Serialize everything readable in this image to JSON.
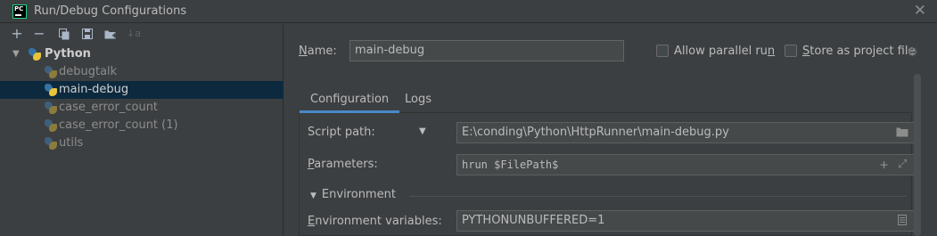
{
  "window": {
    "title": "Run/Debug Configurations",
    "logo_text": "PC"
  },
  "toolbar": {
    "add": "+",
    "remove": "−",
    "sort": "↓a"
  },
  "tree": {
    "group_label": "Python",
    "items": [
      {
        "label": "debugtalk",
        "selected": false
      },
      {
        "label": "main-debug",
        "selected": true
      },
      {
        "label": "case_error_count",
        "selected": false
      },
      {
        "label": "case_error_count (1)",
        "selected": false
      },
      {
        "label": "utils",
        "selected": false
      }
    ]
  },
  "config": {
    "name_label_rest": "ame:",
    "name_label_mnemonic": "N",
    "name_value": "main-debug",
    "allow_parallel_label": "Allow parallel ru",
    "allow_parallel_mnemonic": "n",
    "store_project_label_pre": "",
    "store_project_mnemonic": "S",
    "store_project_label_rest": "tore as project file",
    "allow_parallel_checked": false,
    "store_project_checked": false
  },
  "tabs": [
    {
      "label": "Configuration",
      "active": true
    },
    {
      "label": "Logs",
      "active": false
    }
  ],
  "fields": {
    "script_path_label": "Script path:",
    "script_path_value": "E:\\conding\\Python\\HttpRunner\\main-debug.py",
    "parameters_mnemonic": "P",
    "parameters_label_rest": "arameters:",
    "parameters_value": "hrun $FilePath$",
    "environment_header": "Environment",
    "env_vars_mnemonic": "E",
    "env_vars_label_rest": "nvironment variables:",
    "env_vars_value": "PYTHONUNBUFFERED=1"
  },
  "colors": {
    "background": "#3c3f41",
    "selection": "#0d293e",
    "tab_accent": "#4a88c7",
    "input_bg": "#45494a"
  }
}
